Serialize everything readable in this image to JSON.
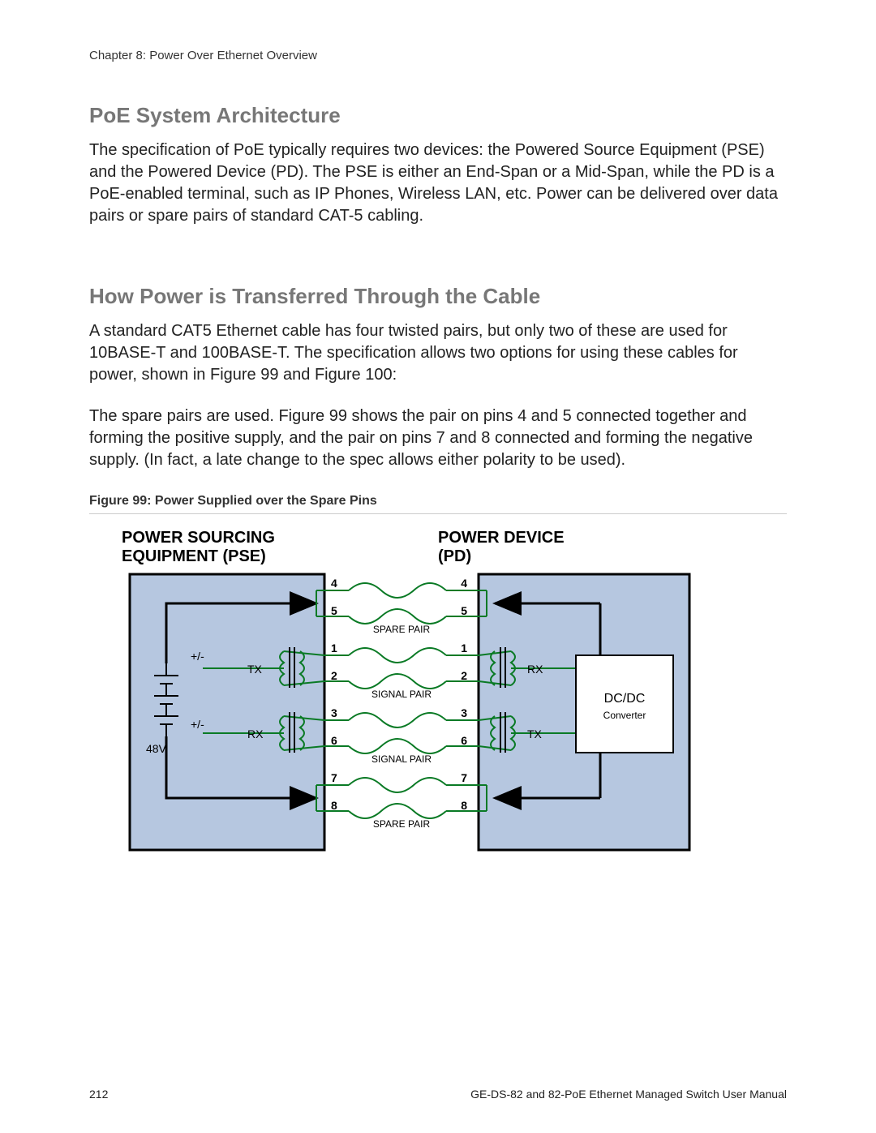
{
  "header": {
    "chapter": "Chapter 8: Power Over Ethernet Overview"
  },
  "section1": {
    "title": "PoE System Architecture",
    "p1": "The specification of PoE typically requires two devices: the Powered Source Equipment (PSE) and the Powered Device (PD). The PSE is either an End-Span or a Mid-Span, while the PD is a PoE-enabled terminal, such as IP Phones, Wireless LAN, etc. Power can be delivered over data pairs or spare pairs of standard CAT-5 cabling."
  },
  "section2": {
    "title": "How Power is Transferred Through the Cable",
    "p1": "A standard CAT5 Ethernet cable has four twisted pairs, but only two of these are used for 10BASE-T and 100BASE-T. The specification allows two options for using these cables for power, shown in Figure 99 and Figure 100:",
    "p2": "The spare pairs are used. Figure 99 shows the pair on pins 4 and 5 connected together and forming the positive supply, and the pair on pins 7 and 8 connected and forming the negative supply. (In fact, a late change to the spec allows either polarity to be used)."
  },
  "figure": {
    "caption": "Figure 99: Power Supplied over the Spare Pins",
    "pse_title_l1": "POWER SOURCING",
    "pse_title_l2": "EQUIPMENT (PSE)",
    "pd_title_l1": "POWER DEVICE",
    "pd_title_l2": "(PD)",
    "labels": {
      "spare_pair": "SPARE PAIR",
      "signal_pair": "SIGNAL PAIR",
      "tx": "TX",
      "rx": "RX",
      "plus_minus": "+/-",
      "voltage": "48V",
      "dcdc": "DC/DC",
      "converter": "Converter",
      "pin1": "1",
      "pin2": "2",
      "pin3": "3",
      "pin4": "4",
      "pin5": "5",
      "pin6": "6",
      "pin7": "7",
      "pin8": "8"
    }
  },
  "footer": {
    "page": "212",
    "doc": "GE-DS-82 and 82-PoE Ethernet Managed Switch User Manual"
  }
}
